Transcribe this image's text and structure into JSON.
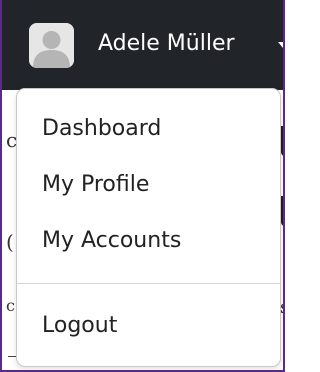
{
  "navbar": {
    "user_name": "Adele Müller",
    "avatar_icon": "user-avatar-icon",
    "caret_icon": "caret-down-icon"
  },
  "dropdown": {
    "items": [
      {
        "label": "Dashboard"
      },
      {
        "label": "My Profile"
      },
      {
        "label": "My Accounts"
      },
      {
        "label": "Logout"
      }
    ]
  },
  "colors": {
    "navbar_bg": "#212529",
    "frame_border": "#5b2a86",
    "menu_text": "#222222"
  }
}
